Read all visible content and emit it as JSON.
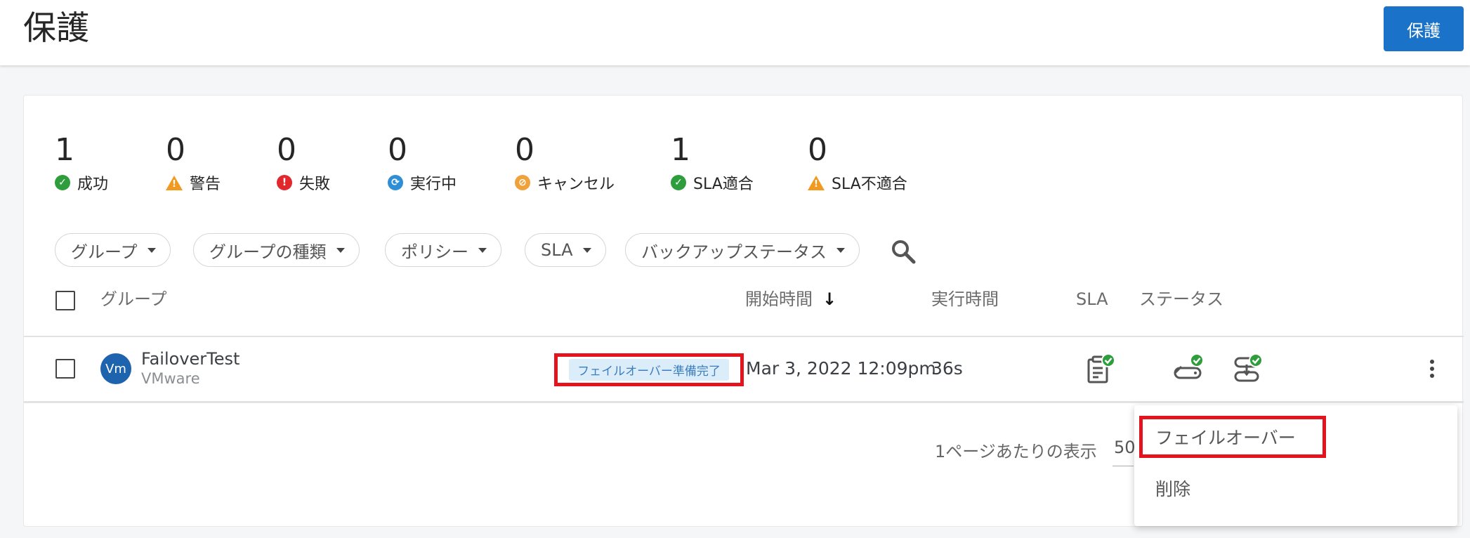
{
  "header": {
    "title": "保護",
    "protect_button": "保護"
  },
  "summary": [
    {
      "count": "1",
      "label": "成功",
      "status": "success"
    },
    {
      "count": "0",
      "label": "警告",
      "status": "warning"
    },
    {
      "count": "0",
      "label": "失敗",
      "status": "failed"
    },
    {
      "count": "0",
      "label": "実行中",
      "status": "running"
    },
    {
      "count": "0",
      "label": "キャンセル",
      "status": "canceled"
    },
    {
      "count": "1",
      "label": "SLA適合",
      "status": "sla-met"
    },
    {
      "count": "0",
      "label": "SLA不適合",
      "status": "sla-missed"
    }
  ],
  "filters": [
    {
      "label": "グループ"
    },
    {
      "label": "グループの種類"
    },
    {
      "label": "ポリシー"
    },
    {
      "label": "SLA"
    },
    {
      "label": "バックアップステータス"
    }
  ],
  "table": {
    "columns": {
      "group": "グループ",
      "start_time": "開始時間",
      "duration": "実行時間",
      "sla": "SLA",
      "status": "ステータス"
    },
    "rows": [
      {
        "avatar": "Vm",
        "name": "FailoverTest",
        "type": "VMware",
        "badge": "フェイルオーバー準備完了",
        "start_time": "Mar 3, 2022 12:09pm",
        "duration": "36s",
        "status_icons": [
          "sla-clipboard-check-icon",
          "backup-storage-check-icon",
          "replication-check-icon"
        ]
      }
    ]
  },
  "pagination": {
    "per_page_label": "1ページあたりの表示",
    "per_page_value": "50"
  },
  "context_menu": {
    "items": [
      "フェイルオーバー",
      "削除"
    ]
  },
  "colors": {
    "primary": "#1a73c9",
    "success": "#2e9e3d",
    "warning": "#f19a1f",
    "danger": "#e0282d",
    "running": "#2e8ed6",
    "highlight": "#e3141d"
  }
}
